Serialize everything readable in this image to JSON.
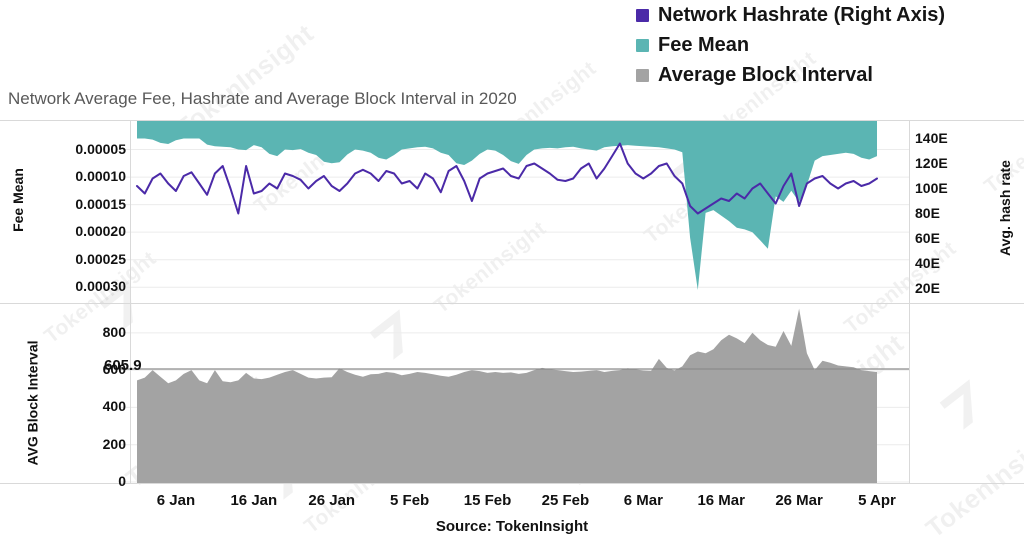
{
  "chart_title": "Network Average Fee, Hashrate and Average Block Interval in 2020",
  "source": "Source: TokenInsight",
  "watermark_text": "TokenInsight",
  "colors": {
    "hashrate": "#4b2aa8",
    "fee_mean": "#5bb5b3",
    "block_interval": "#a3a3a3",
    "title": "#595959",
    "gridline": "#ececec",
    "axisline": "#d9d9d9",
    "refline": "#8c8c8c",
    "text": "#111111",
    "background": "#ffffff"
  },
  "legend": {
    "items": [
      {
        "label": "Network Hashrate (Right Axis)",
        "color": "#4b2aa8"
      },
      {
        "label": "Fee Mean",
        "color": "#5bb5b3"
      },
      {
        "label": "Average Block Interval",
        "color": "#a3a3a3"
      }
    ]
  },
  "axes": {
    "fee_mean": {
      "title": "Fee Mean",
      "inverted": true,
      "ticks": [
        "0.00005",
        "0.00010",
        "0.00015",
        "0.00020",
        "0.00025",
        "0.00030"
      ],
      "tick_values": [
        5e-05,
        0.0001,
        0.00015,
        0.0002,
        0.00025,
        0.0003
      ],
      "range": [
        0.0,
        0.000325
      ]
    },
    "hash_rate": {
      "title": "Avg. hash rate",
      "ticks": [
        "140E",
        "120E",
        "100E",
        "80E",
        "60E",
        "40E",
        "20E"
      ],
      "tick_values": [
        140,
        120,
        100,
        80,
        60,
        40,
        20
      ],
      "range": [
        10,
        150
      ]
    },
    "block_interval": {
      "title": "AVG Block Interval",
      "ticks": [
        "800",
        "600",
        "400",
        "200",
        "0"
      ],
      "tick_values": [
        800,
        600,
        400,
        200,
        0
      ],
      "range": [
        0,
        960
      ]
    },
    "x": {
      "ticks": [
        "6 Jan",
        "16 Jan",
        "26 Jan",
        "5 Feb",
        "15 Feb",
        "25 Feb",
        "6 Mar",
        "16 Mar",
        "26 Mar",
        "5 Apr"
      ],
      "label": ""
    }
  },
  "reference_line": {
    "label": "605.9",
    "value": 605.9
  },
  "chart_data": {
    "type": "line",
    "title": "Network Average Fee, Hashrate and Average Block Interval in 2020",
    "subtitle": "",
    "xlabel": "",
    "ylabel": "Fee Mean",
    "grid": true,
    "legend_position": "top-right",
    "x": [
      "1 Jan",
      "2 Jan",
      "3 Jan",
      "4 Jan",
      "5 Jan",
      "6 Jan",
      "7 Jan",
      "8 Jan",
      "9 Jan",
      "10 Jan",
      "11 Jan",
      "12 Jan",
      "13 Jan",
      "14 Jan",
      "15 Jan",
      "16 Jan",
      "17 Jan",
      "18 Jan",
      "19 Jan",
      "20 Jan",
      "21 Jan",
      "22 Jan",
      "23 Jan",
      "24 Jan",
      "25 Jan",
      "26 Jan",
      "27 Jan",
      "28 Jan",
      "29 Jan",
      "30 Jan",
      "31 Jan",
      "1 Feb",
      "2 Feb",
      "3 Feb",
      "4 Feb",
      "5 Feb",
      "6 Feb",
      "7 Feb",
      "8 Feb",
      "9 Feb",
      "10 Feb",
      "11 Feb",
      "12 Feb",
      "13 Feb",
      "14 Feb",
      "15 Feb",
      "16 Feb",
      "17 Feb",
      "18 Feb",
      "19 Feb",
      "20 Feb",
      "21 Feb",
      "22 Feb",
      "23 Feb",
      "24 Feb",
      "25 Feb",
      "26 Feb",
      "27 Feb",
      "28 Feb",
      "29 Feb",
      "1 Mar",
      "2 Mar",
      "3 Mar",
      "4 Mar",
      "5 Mar",
      "6 Mar",
      "7 Mar",
      "8 Mar",
      "9 Mar",
      "10 Mar",
      "11 Mar",
      "12 Mar",
      "13 Mar",
      "14 Mar",
      "15 Mar",
      "16 Mar",
      "17 Mar",
      "18 Mar",
      "19 Mar",
      "20 Mar",
      "21 Mar",
      "22 Mar",
      "23 Mar",
      "24 Mar",
      "25 Mar",
      "26 Mar",
      "27 Mar",
      "28 Mar",
      "29 Mar",
      "30 Mar",
      "31 Mar",
      "1 Apr",
      "2 Apr",
      "3 Apr",
      "4 Apr",
      "5 Apr"
    ],
    "series": [
      {
        "name": "Fee Mean",
        "type": "area",
        "axis": "left",
        "color": "#5bb5b3",
        "values": [
          3e-05,
          3e-05,
          3.2e-05,
          3.8e-05,
          4e-05,
          3.3e-05,
          3e-05,
          3e-05,
          3e-05,
          4.1e-05,
          4.4e-05,
          4.5e-05,
          4.6e-05,
          5e-05,
          5.1e-05,
          4.2e-05,
          4.6e-05,
          5.8e-05,
          6.2e-05,
          5e-05,
          5.1e-05,
          4.9e-05,
          5.6e-05,
          6e-05,
          7.2e-05,
          7.5e-05,
          7.3e-05,
          5.9e-05,
          5e-05,
          5.2e-05,
          5.6e-05,
          6.5e-05,
          6.8e-05,
          6e-05,
          5e-05,
          4.8e-05,
          4.6e-05,
          4.5e-05,
          4.8e-05,
          5.6e-05,
          6e-05,
          7.5e-05,
          7.8e-05,
          7e-05,
          5.8e-05,
          5e-05,
          5.2e-05,
          6e-05,
          7.1e-05,
          7.6e-05,
          6e-05,
          5e-05,
          4.8e-05,
          4.7e-05,
          4.8e-05,
          4.6e-05,
          4.5e-05,
          4.8e-05,
          5e-05,
          5.2e-05,
          4.6e-05,
          4.4e-05,
          4.3e-05,
          4.2e-05,
          4.3e-05,
          4.4e-05,
          4.5e-05,
          4.6e-05,
          4.8e-05,
          5e-05,
          5.5e-05,
          0.00021,
          0.000305,
          0.000165,
          0.00016,
          0.00017,
          0.00018,
          0.000192,
          0.000195,
          0.0002,
          0.000215,
          0.00023,
          0.000135,
          0.000145,
          0.000125,
          0.000145,
          0.000115,
          7e-05,
          6.2e-05,
          6e-05,
          5.8e-05,
          5.6e-05,
          5.8e-05,
          6.5e-05,
          6.8e-05,
          6.2e-05
        ]
      },
      {
        "name": "Network Hashrate (Right Axis)",
        "type": "line",
        "axis": "right",
        "color": "#4b2aa8",
        "values": [
          102,
          96,
          108,
          112,
          104,
          98,
          110,
          113,
          104,
          95,
          112,
          118,
          100,
          80,
          118,
          96,
          98,
          104,
          100,
          112,
          110,
          107,
          100,
          106,
          110,
          102,
          98,
          104,
          112,
          115,
          112,
          106,
          114,
          112,
          104,
          106,
          100,
          112,
          108,
          97,
          114,
          118,
          106,
          90,
          108,
          112,
          114,
          116,
          110,
          108,
          118,
          120,
          116,
          112,
          107,
          106,
          108,
          116,
          120,
          108,
          116,
          126,
          136,
          120,
          112,
          108,
          112,
          118,
          120,
          110,
          104,
          86,
          80,
          84,
          88,
          92,
          90,
          96,
          92,
          100,
          104,
          96,
          88,
          102,
          112,
          86,
          104,
          108,
          110,
          104,
          100,
          104,
          106,
          102,
          104,
          108
        ]
      },
      {
        "name": "Average Block Interval",
        "type": "area",
        "axis": "lower",
        "color": "#a3a3a3",
        "values": [
          545,
          560,
          600,
          565,
          530,
          545,
          580,
          600,
          545,
          530,
          600,
          540,
          535,
          545,
          585,
          555,
          552,
          560,
          575,
          590,
          600,
          580,
          560,
          555,
          560,
          562,
          610,
          590,
          575,
          565,
          578,
          580,
          590,
          585,
          572,
          580,
          590,
          585,
          578,
          570,
          565,
          575,
          590,
          600,
          595,
          585,
          590,
          585,
          588,
          580,
          585,
          600,
          612,
          605,
          600,
          595,
          590,
          592,
          596,
          600,
          590,
          596,
          600,
          610,
          604,
          598,
          596,
          660,
          612,
          598,
          620,
          680,
          700,
          690,
          712,
          760,
          790,
          770,
          745,
          800,
          760,
          735,
          725,
          810,
          730,
          930,
          690,
          600,
          650,
          640,
          625,
          620,
          615,
          600,
          595,
          590
        ]
      }
    ]
  }
}
